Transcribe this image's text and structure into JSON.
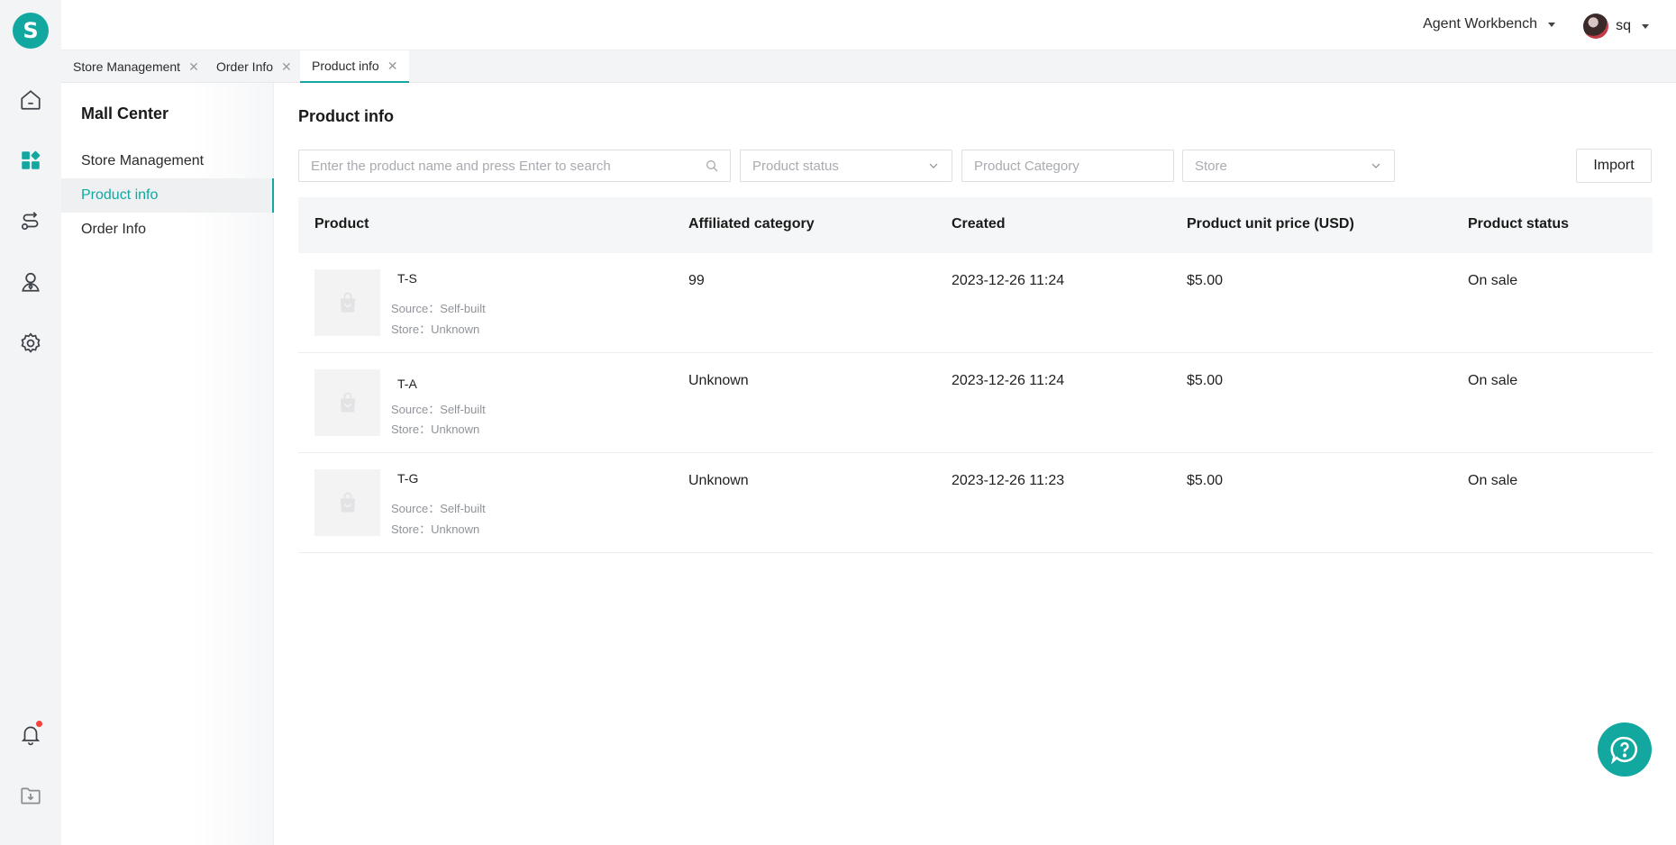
{
  "app": {
    "logo_letter": "S",
    "accent": "#12a8a0"
  },
  "rail": {
    "items": [
      "home-icon",
      "apps-icon",
      "route-icon",
      "agent-icon",
      "gear-icon"
    ],
    "bottom": [
      "bell-icon",
      "download-folder-icon"
    ]
  },
  "header": {
    "workbench_label": "Agent Workbench",
    "user_name": "sq"
  },
  "tabs": [
    {
      "label": "Store Management",
      "close": "✕"
    },
    {
      "label": "Order Info",
      "close": "✕"
    },
    {
      "label": "Product info",
      "close": "✕"
    }
  ],
  "subnav": {
    "title": "Mall Center",
    "items": [
      {
        "label": "Store Management"
      },
      {
        "label": "Product info"
      },
      {
        "label": "Order Info"
      }
    ]
  },
  "main": {
    "title": "Product info",
    "filters": {
      "search_placeholder": "Enter the product name and press Enter to search",
      "status_placeholder": "Product status",
      "category_placeholder": "Product Category",
      "store_placeholder": "Store"
    },
    "import_label": "Import",
    "columns": [
      "Product",
      "Affiliated category",
      "Created",
      "Product unit price (USD)",
      "Product status"
    ],
    "rows": [
      {
        "name": "T-S",
        "source": "Source：Self-built",
        "store": "Store：Unknown",
        "category": "99",
        "created": "2023-12-26 11:24",
        "price": "$5.00",
        "status": "On sale"
      },
      {
        "name": "T-A",
        "source": "Source：Self-built",
        "store": "Store：Unknown",
        "category": "Unknown",
        "created": "2023-12-26 11:24",
        "price": "$5.00",
        "status": "On sale"
      },
      {
        "name": "T-G",
        "source": "Source：Self-built",
        "store": "Store：Unknown",
        "category": "Unknown",
        "created": "2023-12-26 11:23",
        "price": "$5.00",
        "status": "On sale"
      }
    ]
  }
}
